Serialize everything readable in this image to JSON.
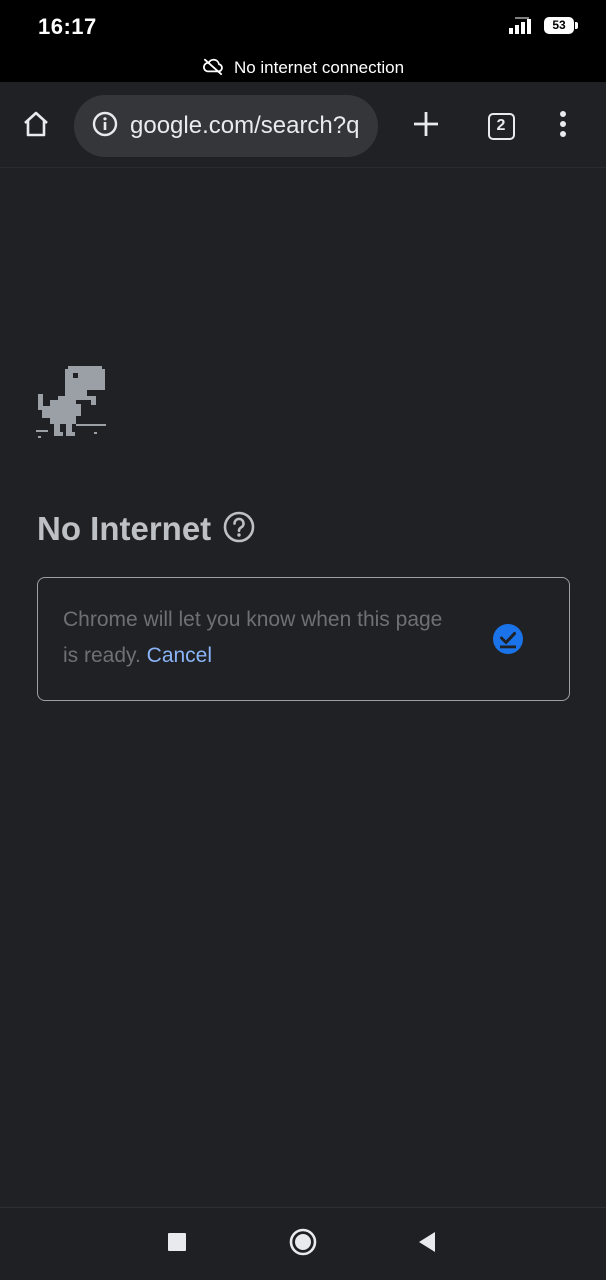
{
  "status_bar": {
    "time": "16:17",
    "battery_level": "53",
    "icons": [
      "signal-icon",
      "battery-icon"
    ]
  },
  "offline_banner": {
    "text": "No internet connection",
    "icon": "cloud-off-icon"
  },
  "toolbar": {
    "url": "google.com/search?q",
    "tab_count": "2",
    "icons": [
      "home-icon",
      "info-icon",
      "plus-icon",
      "tab-switcher-icon",
      "more-vert-icon"
    ]
  },
  "error_page": {
    "heading": "No Internet",
    "message_prefix": "Chrome will let you know when this page is ready.",
    "cancel_label": "Cancel",
    "icons": [
      "dino-icon",
      "help-icon",
      "download-later-icon"
    ]
  },
  "nav_bar": {
    "icons": [
      "recents-icon",
      "home-circle-icon",
      "back-icon"
    ]
  },
  "colors": {
    "background": "#202124",
    "status_bar": "#000000",
    "omnibox": "#35363a",
    "link": "#8ab4f8",
    "accent": "#1a73e8"
  }
}
